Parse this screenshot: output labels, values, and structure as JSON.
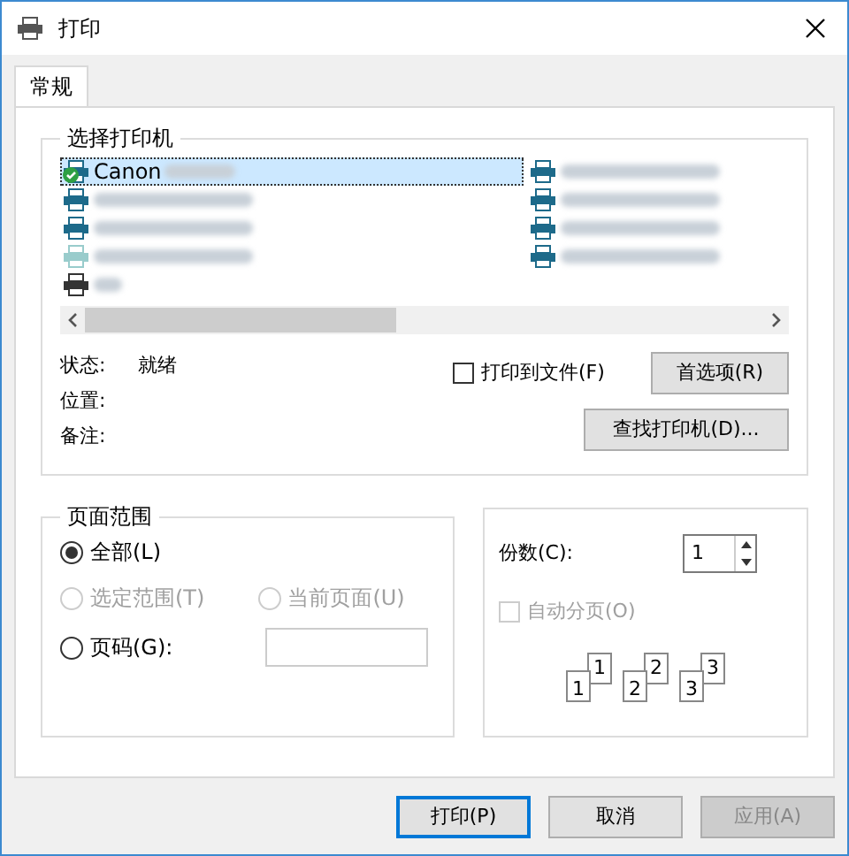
{
  "window": {
    "title": "打印"
  },
  "tabs": [
    {
      "label": "常规",
      "selected": true
    }
  ],
  "printer_group": {
    "title": "选择打印机",
    "printers": [
      {
        "name": "Canon",
        "kind": "default",
        "selected": true
      },
      {
        "kind": "normal",
        "selected": false
      },
      {
        "kind": "normal",
        "selected": false
      },
      {
        "kind": "offline",
        "selected": false
      },
      {
        "kind": "fax",
        "selected": false
      },
      {
        "kind": "normal",
        "selected": false
      },
      {
        "kind": "normal",
        "selected": false
      },
      {
        "kind": "normal",
        "selected": false
      },
      {
        "kind": "normal",
        "selected": false
      }
    ],
    "status": [
      {
        "label": "状态:",
        "value": "就绪"
      },
      {
        "label": "位置:"
      },
      {
        "label": "备注:"
      }
    ],
    "print_to_file": {
      "label": "打印到文件(F)",
      "checked": false
    },
    "preferences_button": "首选项(R)",
    "find_printer_button": "查找打印机(D)..."
  },
  "page_range": {
    "title": "页面范围",
    "options": [
      {
        "label": "全部(L)",
        "selected": true,
        "disabled": false
      },
      {
        "label": "选定范围(T)",
        "selected": false,
        "disabled": true
      },
      {
        "label": "当前页面(U)",
        "selected": false,
        "disabled": true
      },
      {
        "label": "页码(G):",
        "selected": false,
        "disabled": false
      }
    ]
  },
  "copies": {
    "label": "份数(C):",
    "value": "1",
    "collate": {
      "label": "自动分页(O)",
      "checked": false,
      "disabled": true
    },
    "collate_pages": [
      "1",
      "1",
      "2",
      "2",
      "3",
      "3"
    ]
  },
  "buttons": [
    {
      "label": "打印(P)",
      "disabled": false,
      "default": true
    },
    {
      "label": "取消",
      "disabled": false,
      "default": false
    },
    {
      "label": "应用(A)",
      "disabled": true,
      "default": false
    }
  ]
}
